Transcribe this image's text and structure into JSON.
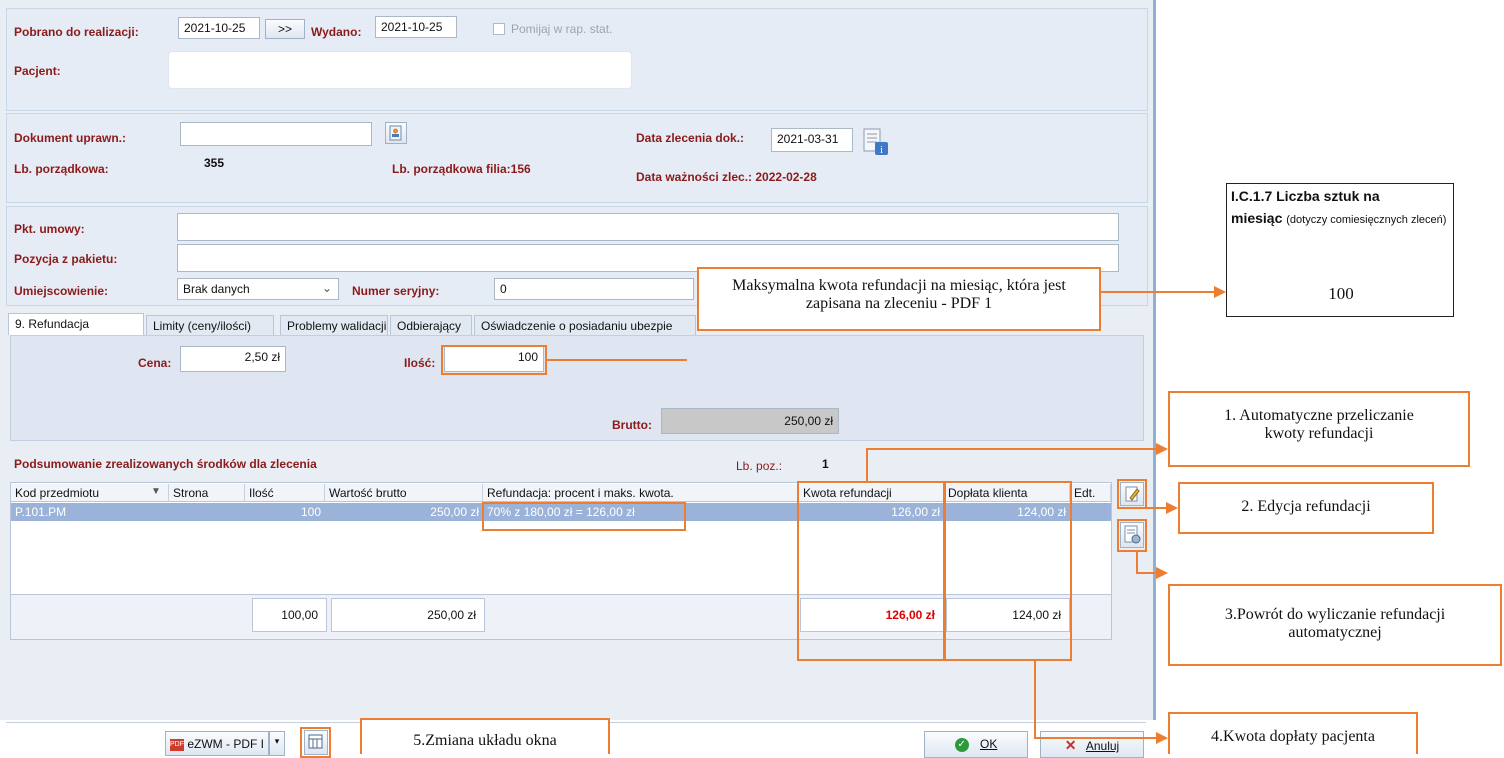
{
  "form": {
    "pobrano_label": "Pobrano do realizacji:",
    "pobrano_value": "2021-10-25",
    "next_button": ">>",
    "wydano_label": "Wydano:",
    "wydano_value": "2021-10-25",
    "pomijaj_label": "Pomijaj w rap. stat.",
    "pacjent_label": "Pacjent:",
    "dokument_label": "Dokument uprawn.:",
    "lb_porz_label": "Lb. porządkowa:",
    "lb_porz_value": "355",
    "lb_porz_filia": "Lb. porządkowa filia:156",
    "data_zlecenia_label": "Data zlecenia dok.:",
    "data_zlecenia_value": "2021-03-31",
    "data_waznosci": "Data ważności zlec.: 2022-02-28",
    "pkt_umowy_label": "Pkt. umowy:",
    "pozycja_label": "Pozycja z pakietu:",
    "umiejscowienie_label": "Umiejscowienie:",
    "umiejscowienie_value": "Brak danych",
    "numer_seryjny_label": "Numer seryjny:",
    "numer_seryjny_value": "0"
  },
  "tabs": [
    {
      "label": "9. Refundacja"
    },
    {
      "label": "Limity (ceny/ilości)"
    },
    {
      "label": "Problemy walidacji"
    },
    {
      "label": "Odbierający"
    },
    {
      "label": "Oświadczenie o posiadaniu ubezpie"
    }
  ],
  "refund": {
    "cena_label": "Cena:",
    "cena_value": "2,50 zł",
    "ilosc_label": "Ilość:",
    "ilosc_value": "100",
    "brutto_label": "Brutto:",
    "brutto_value": "250,00 zł"
  },
  "summary": {
    "title": "Podsumowanie zrealizowanych środków dla zlecenia",
    "lb_poz_label": "Lb. poz.:",
    "lb_poz_value": "1",
    "columns": [
      "Kod przedmiotu",
      "Strona",
      "Ilość",
      "Wartość brutto",
      "Refundacja: procent i maks. kwota.",
      "Kwota refundacji",
      "Dopłata klienta",
      "Edt."
    ],
    "row": {
      "kod": "P.101.PM",
      "strona": "",
      "ilosc": "100",
      "wartosc": "250,00 zł",
      "refundacja": "70% z 180,00 zł = 126,00 zł",
      "kwota": "126,00 zł",
      "doplata": "124,00 zł"
    },
    "totals": {
      "ilosc": "100,00",
      "wartosc": "250,00 zł",
      "kwota": "126,00 zł",
      "doplata": "124,00 zł"
    }
  },
  "footer": {
    "ezwm_label": "eZWM - PDF I",
    "ok_label": "OK",
    "anuluj_label": "Anuluj"
  },
  "callouts": {
    "max_kwota": "Maksymalna kwota refundacji na miesiąc, która jest zapisana na zleceniu - PDF 1",
    "c1": "1. Automatyczne przeliczanie kwoty refundacji",
    "c2": "2. Edycja refundacji",
    "c3": "3.Powrót do wyliczanie refundacji automatycznej",
    "c4": "4.Kwota dopłaty pacjenta",
    "c5": "5.Zmiana układu okna"
  },
  "pdf_snippet": {
    "title": "I.C.1.7 Liczba sztuk na",
    "title2": "miesiąc",
    "note": "(dotyczy comiesięcznych zleceń)",
    "value": "100"
  },
  "colors": {
    "accent": "#ed7d31",
    "label": "#8b1a1a",
    "selected_row": "#9bb2d9",
    "red_total": "#e00000"
  }
}
